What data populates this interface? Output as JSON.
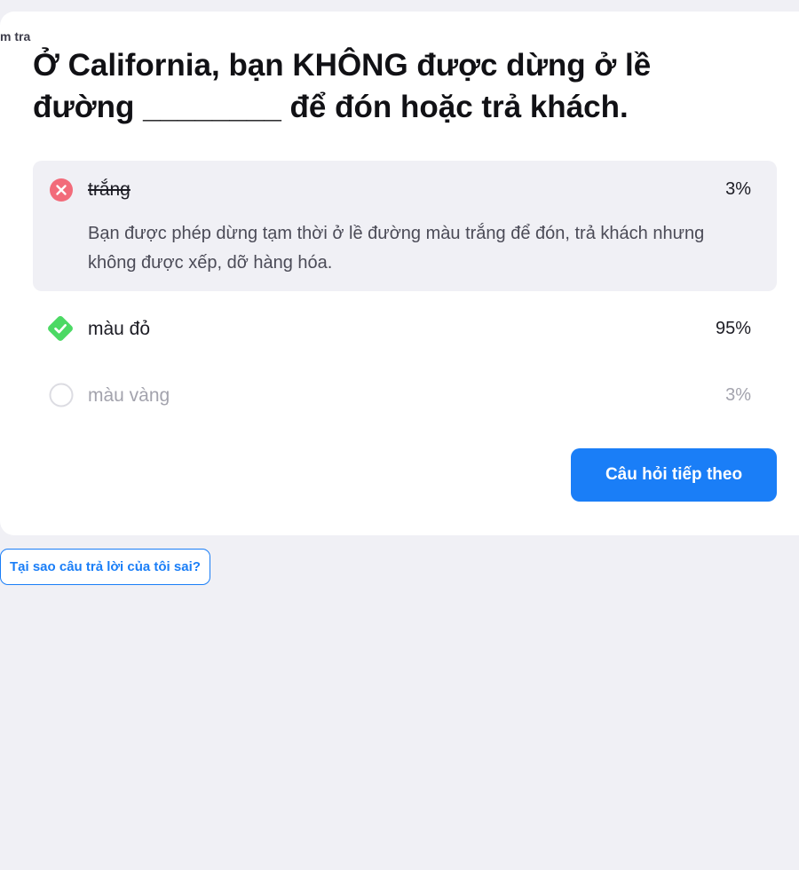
{
  "category": {
    "label": "m tra"
  },
  "question": {
    "text": "Ở California, bạn KHÔNG được dừng ở lề đường ________ để đón hoặc trả khách."
  },
  "answers": [
    {
      "label": "trắng",
      "percent": "3%",
      "state": "wrong",
      "explanation": "Bạn được phép dừng tạm thời ở lề đường màu trắng để đón, trả khách nhưng không được xếp, dỡ hàng hóa.",
      "icon": "x-circle-icon"
    },
    {
      "label": "màu đỏ",
      "percent": "95%",
      "state": "correct",
      "icon": "check-diamond-icon"
    },
    {
      "label": "màu vàng",
      "percent": "3%",
      "state": "unselected",
      "icon": "empty-circle-icon"
    }
  ],
  "actions": {
    "next_label": "Câu hỏi tiếp theo",
    "why_wrong_label": "Tại sao câu trả lời của tôi sai?"
  },
  "colors": {
    "accent": "#1a7ef7",
    "wrong": "#f26b7a",
    "correct": "#4cd964",
    "background": "#f0f0f5"
  }
}
